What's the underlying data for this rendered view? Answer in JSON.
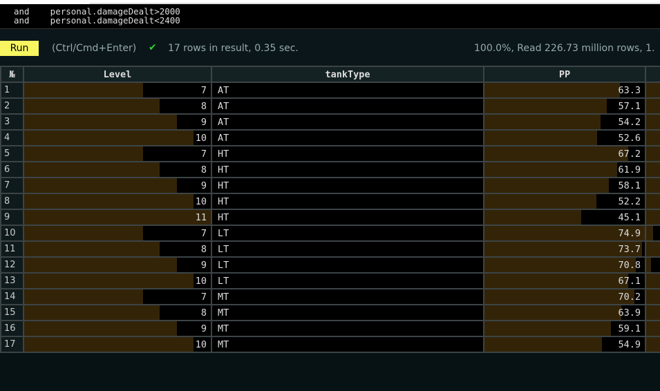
{
  "query": {
    "lines": [
      "and    personal.damageDealt>2000",
      "and    personal.damageDealt<2400"
    ]
  },
  "toolbar": {
    "run_label": "Run",
    "hint": "(Ctrl/Cmd+Enter)",
    "status": "17 rows in result, 0.35 sec.",
    "progress": "100.0%, Read 226.73 million rows, 1."
  },
  "table": {
    "headers": [
      "№",
      "Level",
      "tankType",
      "PP",
      ""
    ],
    "rows": [
      {
        "n": "1",
        "level": 7,
        "type": "AT",
        "pp": 63.3
      },
      {
        "n": "2",
        "level": 8,
        "type": "AT",
        "pp": 57.1
      },
      {
        "n": "3",
        "level": 9,
        "type": "AT",
        "pp": 54.2
      },
      {
        "n": "4",
        "level": 10,
        "type": "AT",
        "pp": 52.6
      },
      {
        "n": "5",
        "level": 7,
        "type": "HT",
        "pp": 67.2
      },
      {
        "n": "6",
        "level": 8,
        "type": "HT",
        "pp": 61.9
      },
      {
        "n": "7",
        "level": 9,
        "type": "HT",
        "pp": 58.1
      },
      {
        "n": "8",
        "level": 10,
        "type": "HT",
        "pp": 52.2
      },
      {
        "n": "9",
        "level": 11,
        "type": "HT",
        "pp": 45.1
      },
      {
        "n": "10",
        "level": 7,
        "type": "LT",
        "pp": 74.9
      },
      {
        "n": "11",
        "level": 8,
        "type": "LT",
        "pp": 73.7
      },
      {
        "n": "12",
        "level": 9,
        "type": "LT",
        "pp": 70.8
      },
      {
        "n": "13",
        "level": 10,
        "type": "LT",
        "pp": 67.1
      },
      {
        "n": "14",
        "level": 7,
        "type": "MT",
        "pp": 70.2
      },
      {
        "n": "15",
        "level": 8,
        "type": "MT",
        "pp": 63.9
      },
      {
        "n": "16",
        "level": 9,
        "type": "MT",
        "pp": 59.1
      },
      {
        "n": "17",
        "level": 10,
        "type": "MT",
        "pp": 54.9
      }
    ],
    "extra_col_fill": [
      0.9,
      0.9,
      0.9,
      0.9,
      0.9,
      0.9,
      0.9,
      0.9,
      0.9,
      0.15,
      0.4,
      0.1,
      0.9,
      0.3,
      0.9,
      0.9,
      0.9
    ]
  }
}
